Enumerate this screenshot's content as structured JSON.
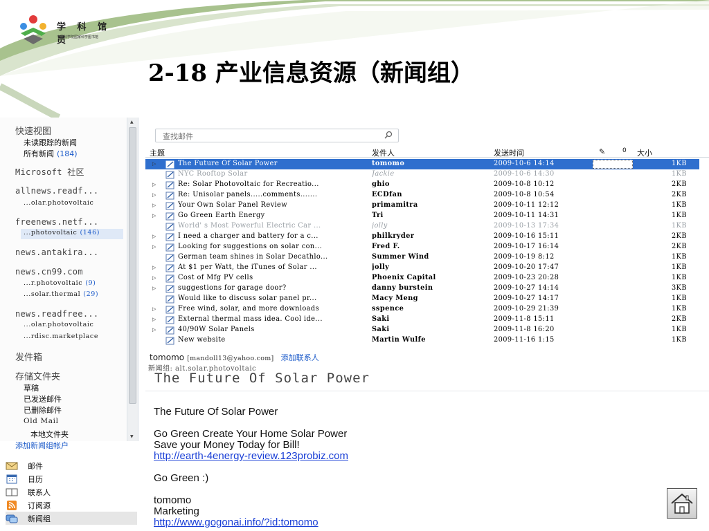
{
  "slide": {
    "title": "2-18 产业信息资源（新闻组）",
    "logo_text": "学 科 馆 员",
    "logo_subtext": "中国科学院国家科学图书馆"
  },
  "folders": {
    "quick_views": "快速视图",
    "unread_tracked": "未读跟踪的新闻",
    "all_news": "所有新闻",
    "all_news_count": "(184)",
    "ms_community": "Microsoft 社区",
    "servers": [
      {
        "name": "allnews.readf...",
        "children": [
          {
            "name": "...olar.photovoltaic",
            "count": ""
          }
        ]
      },
      {
        "name": "freenews.netf...",
        "children": [
          {
            "name": "...photovoltaic",
            "count": "(146)"
          }
        ]
      },
      {
        "name": "news.antakira...",
        "children": []
      },
      {
        "name": "news.cn99.com",
        "children": [
          {
            "name": "...r.photovoltaic",
            "count": "(9)"
          },
          {
            "name": "...solar.thermal",
            "count": "(29)"
          }
        ]
      },
      {
        "name": "news.readfree...",
        "children": [
          {
            "name": "...olar.photovoltaic",
            "count": ""
          },
          {
            "name": "...rdisc.marketplace",
            "count": ""
          }
        ]
      }
    ],
    "outbox": "发件箱",
    "storage": "存储文件夹",
    "storage_items": [
      "草稿",
      "已发送邮件",
      "已删除邮件",
      "Old Mail",
      "本地文件夹"
    ],
    "add_account": "添加新闻组帐户"
  },
  "nav": {
    "items": [
      {
        "label": "邮件",
        "icon": "mail-icon"
      },
      {
        "label": "日历",
        "icon": "calendar-icon"
      },
      {
        "label": "联系人",
        "icon": "contacts-icon"
      },
      {
        "label": "订阅源",
        "icon": "rss-icon"
      },
      {
        "label": "新闻组",
        "icon": "newsgroup-icon"
      }
    ]
  },
  "search": {
    "placeholder": "查找邮件"
  },
  "list": {
    "columns": {
      "subject": "主题",
      "from": "发件人",
      "sent": "发送时间",
      "flag": "✎",
      "attach": "0",
      "size": "大小"
    },
    "rows": [
      {
        "thread": "▷",
        "subject": "The Future Of Solar Power",
        "from": "tomomo",
        "sent": "2009-10-6 14:14",
        "size": "1KB",
        "state": "selected"
      },
      {
        "thread": "",
        "subject": "NYC Rooftop Solar",
        "from": "Jackie",
        "sent": "2009-10-6 14:30",
        "size": "1KB",
        "state": "read"
      },
      {
        "thread": "▷",
        "subject": "Re: Solar Photovoltaic for Recreatio...",
        "from": "ghio",
        "sent": "2009-10-8 10:12",
        "size": "2KB",
        "state": "unread"
      },
      {
        "thread": "▷",
        "subject": "Re: Unisolar panels.....comments.......",
        "from": "ECDfan",
        "sent": "2009-10-8 10:54",
        "size": "2KB",
        "state": "unread"
      },
      {
        "thread": "▷",
        "subject": "Your Own Solar Panel Review",
        "from": "primamitra",
        "sent": "2009-10-11 12:12",
        "size": "1KB",
        "state": "unread"
      },
      {
        "thread": "▷",
        "subject": "Go Green Earth Energy",
        "from": "Tri",
        "sent": "2009-10-11 14:31",
        "size": "1KB",
        "state": "unread"
      },
      {
        "thread": "",
        "subject": "World' s Most Powerful Electric Car ...",
        "from": "jolly",
        "sent": "2009-10-13 17:34",
        "size": "1KB",
        "state": "read"
      },
      {
        "thread": "▷",
        "subject": "I need a charger and battery for a c...",
        "from": "philkryder",
        "sent": "2009-10-16 15:11",
        "size": "2KB",
        "state": "unread"
      },
      {
        "thread": "▷",
        "subject": "Looking for suggestions on solar con...",
        "from": "Fred F.",
        "sent": "2009-10-17 16:14",
        "size": "2KB",
        "state": "unread"
      },
      {
        "thread": "",
        "subject": "German team shines in Solar Decathlo...",
        "from": "Summer Wind",
        "sent": "2009-10-19 8:12",
        "size": "1KB",
        "state": "unread"
      },
      {
        "thread": "▷",
        "subject": "At $1 per Watt, the iTunes of Solar ...",
        "from": "jolly",
        "sent": "2009-10-20 17:47",
        "size": "1KB",
        "state": "unread"
      },
      {
        "thread": "▷",
        "subject": "Cost of Mfg PV cells",
        "from": "Phoenix Capital",
        "sent": "2009-10-23 20:28",
        "size": "1KB",
        "state": "unread"
      },
      {
        "thread": "▷",
        "subject": "suggestions for garage door?",
        "from": "danny burstein",
        "sent": "2009-10-27 14:14",
        "size": "3KB",
        "state": "unread"
      },
      {
        "thread": "",
        "subject": "Would like to discuss solar panel pr...",
        "from": "Macy Meng",
        "sent": "2009-10-27 14:17",
        "size": "1KB",
        "state": "unread"
      },
      {
        "thread": "▷",
        "subject": "Free wind, solar, and more downloads",
        "from": "sspence",
        "sent": "2009-10-29 21:39",
        "size": "1KB",
        "state": "unread"
      },
      {
        "thread": "▷",
        "subject": "External thermal mass idea. Cool ide...",
        "from": "Saki",
        "sent": "2009-11-8 15:11",
        "size": "2KB",
        "state": "unread"
      },
      {
        "thread": "▷",
        "subject": "40/90W Solar Panels",
        "from": "Saki",
        "sent": "2009-11-8 16:20",
        "size": "1KB",
        "state": "unread"
      },
      {
        "thread": "",
        "subject": "New website",
        "from": "Martin Wulfe",
        "sent": "2009-11-16 1:15",
        "size": "1KB",
        "state": "unread"
      }
    ]
  },
  "preview": {
    "sender_name": "tomomo",
    "sender_email": "[mandoll13@yahoo.com]",
    "add_contact": "添加联系人",
    "newsgroup_line": "新闻组: alt.solar.photovoltaic",
    "subject": "The Future Of Solar Power",
    "body": {
      "line1": "The Future Of Solar Power",
      "line2": "Go Green Create Your Home Solar Power",
      "line3": "Save your Money Today for Bill!",
      "link1": "http://earth-4energy-review.123probiz.com",
      "line4": "Go Green :)",
      "line5": "tomomo",
      "line6": "Marketing",
      "link2": "http://www.gogonai.info/?id:tomomo"
    }
  },
  "colors": {
    "selection": "#2f6fce",
    "link": "#1a3fd6",
    "accent_green": "#7aa05a"
  }
}
